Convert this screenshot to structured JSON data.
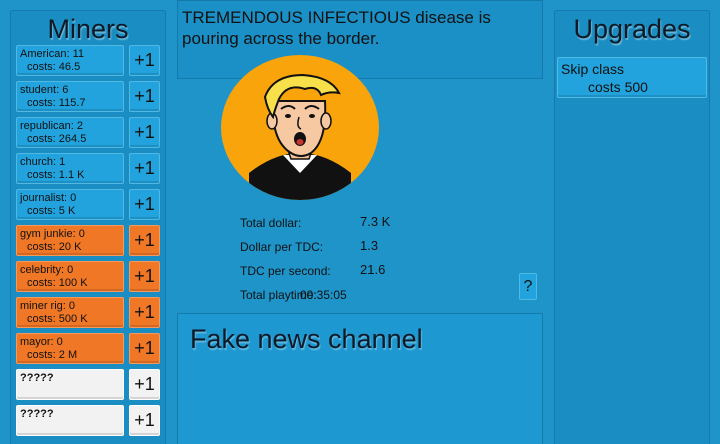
{
  "miners_panel": {
    "title": "Miners",
    "items": [
      {
        "name": "American: 11",
        "cost": "costs: 46.5",
        "plus": "+1"
      },
      {
        "name": "student: 6",
        "cost": "costs: 115.7",
        "plus": "+1"
      },
      {
        "name": "republican: 2",
        "cost": "costs: 264.5",
        "plus": "+1"
      },
      {
        "name": "church: 1",
        "cost": "costs: 1.1 K",
        "plus": "+1"
      },
      {
        "name": "journalist: 0",
        "cost": "costs: 5 K",
        "plus": "+1"
      },
      {
        "name": "gym junkie: 0",
        "cost": "costs: 20 K",
        "plus": "+1"
      },
      {
        "name": "celebrity: 0",
        "cost": "costs: 100 K",
        "plus": "+1"
      },
      {
        "name": "miner rig: 0",
        "cost": "costs: 500 K",
        "plus": "+1"
      },
      {
        "name": "mayor: 0",
        "cost": "costs: 2 M",
        "plus": "+1"
      },
      {
        "name": "?????",
        "cost": "",
        "plus": "+1"
      },
      {
        "name": "?????",
        "cost": "",
        "plus": "+1"
      }
    ]
  },
  "news": {
    "text": "TREMENDOUS INFECTIOUS disease is pouring across the border."
  },
  "stats": {
    "total_dollar_label": "Total dollar:",
    "total_dollar_value": "7.3 K",
    "dollar_per_tdc_label": "Dollar per TDC:",
    "dollar_per_tdc_value": "1.3",
    "tdc_per_second_label": "TDC per second:",
    "tdc_per_second_value": "21.6",
    "total_playtime_label": "Total playtime:",
    "total_playtime_value": "00:35:05"
  },
  "help_button": "?",
  "channel": {
    "title": "Fake news channel"
  },
  "upgrades_panel": {
    "title": "Upgrades",
    "items": [
      {
        "name": "Skip class",
        "cost": "costs 500"
      }
    ]
  },
  "colors": {
    "background": "#1e94c9",
    "affordable_card": "#22a3dd",
    "unaffordable_card": "#ef7726",
    "locked_card": "#f2f2f2",
    "clicker_circle": "#f9a40a"
  }
}
